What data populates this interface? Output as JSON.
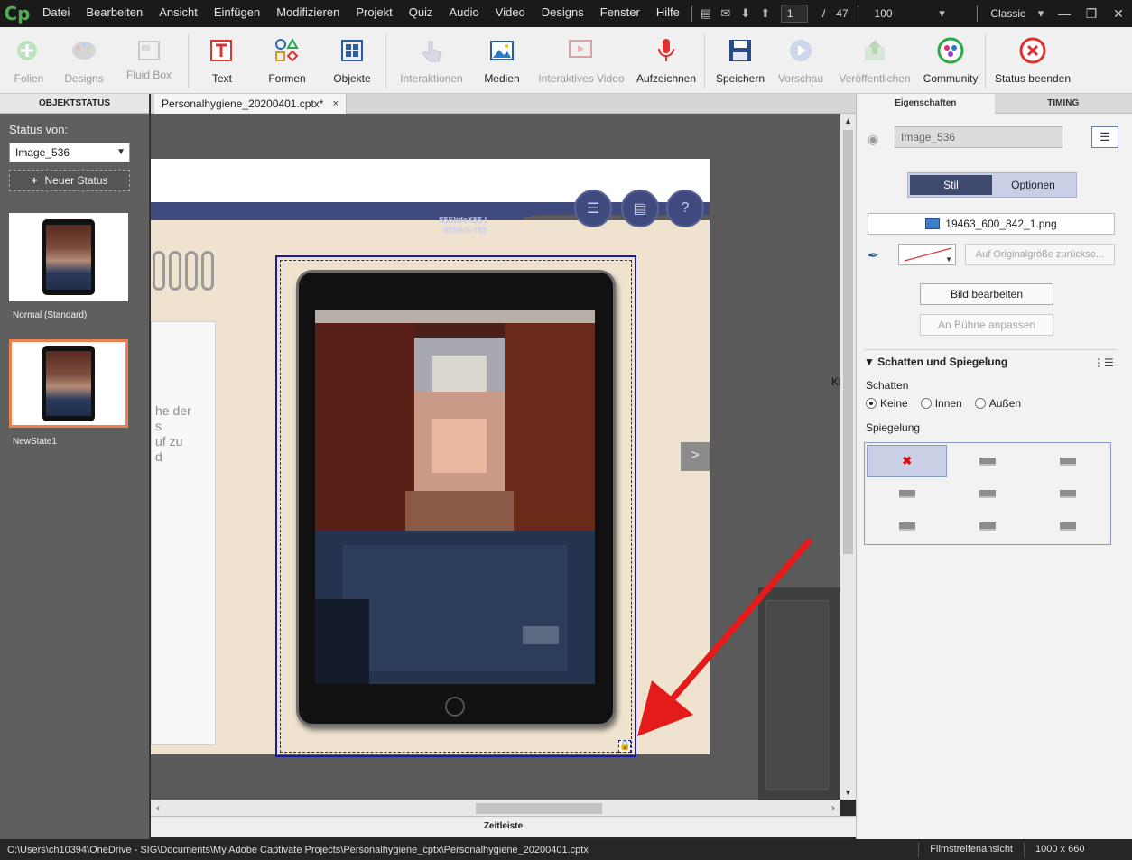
{
  "menubar": {
    "logo": "Cp",
    "items": [
      "Datei",
      "Bearbeiten",
      "Ansicht",
      "Einfügen",
      "Modifizieren",
      "Projekt",
      "Quiz",
      "Audio",
      "Video",
      "Designs",
      "Fenster",
      "Hilfe"
    ],
    "current_slide": "1",
    "slide_separator": "/",
    "total_slides": "47",
    "zoom": "100",
    "workspace": "Classic"
  },
  "toolbar": {
    "buttons": [
      {
        "label": "Folien",
        "icon": "add-slide-icon",
        "enabled": false
      },
      {
        "label": "Designs",
        "icon": "palette-icon",
        "enabled": false
      },
      {
        "label": "Fluid Box",
        "icon": "fluid-box-icon",
        "enabled": false
      },
      {
        "label": "Text",
        "icon": "text-caption-icon",
        "enabled": true
      },
      {
        "label": "Formen",
        "icon": "shapes-icon",
        "enabled": true
      },
      {
        "label": "Objekte",
        "icon": "objects-icon",
        "enabled": true
      },
      {
        "label": "Interaktionen",
        "icon": "interactions-icon",
        "enabled": false
      },
      {
        "label": "Medien",
        "icon": "media-icon",
        "enabled": true
      },
      {
        "label": "Interaktives Video",
        "icon": "interactive-video-icon",
        "enabled": false
      },
      {
        "label": "Aufzeichnen",
        "icon": "microphone-icon",
        "enabled": true
      },
      {
        "label": "Speichern",
        "icon": "save-icon",
        "enabled": true
      },
      {
        "label": "Vorschau",
        "icon": "play-icon",
        "enabled": false
      },
      {
        "label": "Veröffentlichen",
        "icon": "publish-icon",
        "enabled": false
      },
      {
        "label": "Community",
        "icon": "community-icon",
        "enabled": true
      },
      {
        "label": "Status beenden",
        "icon": "close-circle-icon",
        "enabled": true
      }
    ]
  },
  "left_panel": {
    "header": "OBJEKTSTATUS",
    "status_label": "Status von:",
    "status_value": "Image_536",
    "new_state_label": "Neuer Status",
    "states": [
      {
        "label": "Normal (Standard)",
        "selected": false
      },
      {
        "label": "NewState1",
        "selected": true
      }
    ]
  },
  "document": {
    "tab_title": "Personalhygiene_20200401.cptx*",
    "tab_close": "×"
  },
  "slide": {
    "vars": [
      "$$SlideX$$ |",
      "$$SlideY$$"
    ],
    "nav_icons": [
      "list-icon",
      "book-icon",
      "help-icon"
    ],
    "notebook_text": [
      "he der",
      "s",
      "uf zu",
      "d"
    ],
    "next_label": ">",
    "right_letter": "Kl"
  },
  "timeline": {
    "label": "Zeitleiste"
  },
  "right_panel": {
    "tabs": [
      {
        "label": "Eigenschaften",
        "active": true
      },
      {
        "label": "TIMING",
        "active": false
      }
    ],
    "object_name": "Image_536",
    "segments": [
      {
        "label": "Stil",
        "active": true
      },
      {
        "label": "Optionen",
        "active": false
      }
    ],
    "file_name": "19463_600_842_1.png",
    "reset_size": "Auf Originalgröße zurückse...",
    "edit_image": "Bild bearbeiten",
    "fit_stage": "An Bühne anpassen",
    "section_title": "Schatten und Spiegelung",
    "shadow_label": "Schatten",
    "shadow_options": [
      {
        "label": "Keine",
        "checked": true
      },
      {
        "label": "Innen",
        "checked": false
      },
      {
        "label": "Außen",
        "checked": false
      }
    ],
    "reflection_label": "Spiegelung"
  },
  "statusbar": {
    "path": "C:\\Users\\ch10394\\OneDrive - SIG\\Documents\\My Adobe Captivate Projects\\Personalhygiene_cptx\\Personalhygiene_20200401.cptx",
    "view": "Filmstreifenansicht",
    "size": "1000 x 660"
  },
  "colors": {
    "accent": "#f08050",
    "selection": "#1a1aa8",
    "annotation_arrow": "#e51a1a",
    "slide_header": "#3f4a7e"
  }
}
